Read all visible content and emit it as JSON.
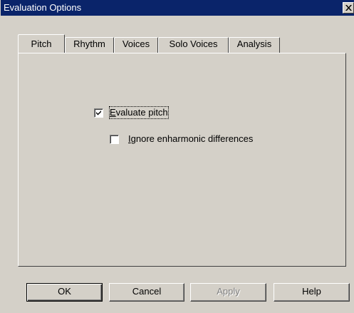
{
  "window": {
    "title": "Evaluation Options"
  },
  "tabs": [
    {
      "label": "Pitch",
      "active": true
    },
    {
      "label": "Rhythm",
      "active": false
    },
    {
      "label": "Voices",
      "active": false
    },
    {
      "label": "Solo Voices",
      "active": false
    },
    {
      "label": "Analysis",
      "active": false
    }
  ],
  "pitch": {
    "evaluate_pitch": {
      "label_prefix": "E",
      "label_rest": "valuate pitch",
      "checked": true
    },
    "ignore_enharmonic": {
      "label_prefix": "I",
      "label_rest": "gnore enharmonic differences",
      "checked": false
    }
  },
  "buttons": {
    "ok": "OK",
    "cancel": "Cancel",
    "apply": "Apply",
    "help": "Help"
  },
  "icons": {
    "close": "close-icon",
    "check": "checkmark-icon"
  },
  "colors": {
    "titlebar": "#0a246a",
    "face": "#d4d0c8"
  }
}
